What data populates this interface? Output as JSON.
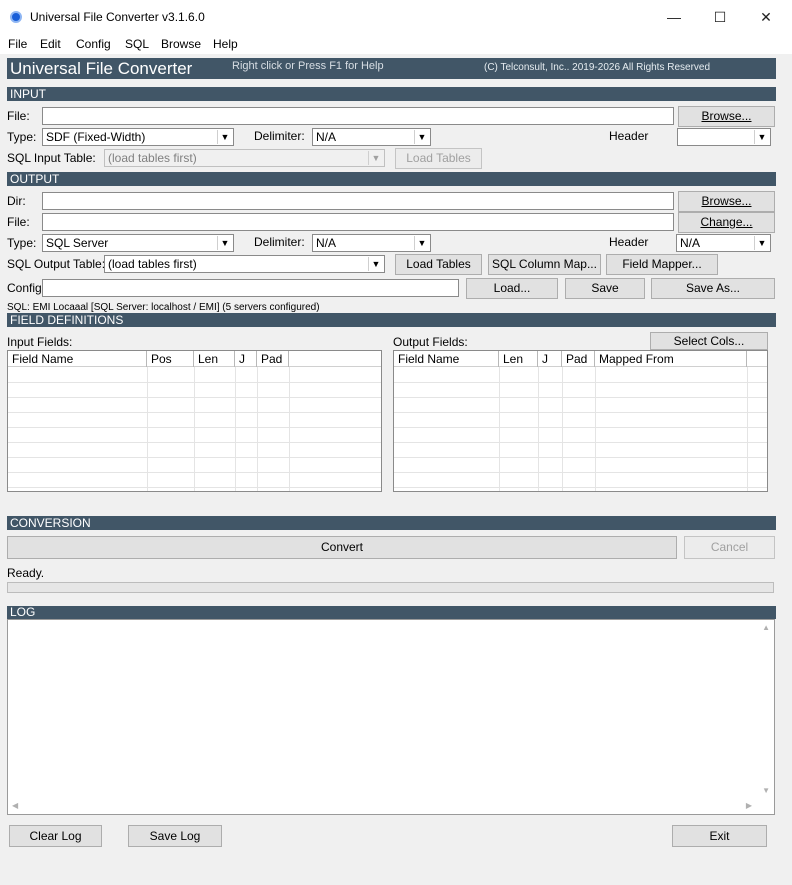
{
  "window": {
    "title": "Universal File Converter  v3.1.6.0",
    "minimize": "—",
    "maximize": "☐",
    "close": "✕"
  },
  "menu": [
    "File",
    "Edit",
    "Config",
    "SQL",
    "Browse",
    "Help"
  ],
  "banner": {
    "title": "Universal File Converter",
    "help": "Right click or Press F1 for Help",
    "copyright": "(C) Telconsult, Inc..  2019-2026  All Rights Reserved"
  },
  "input": {
    "section": "INPUT",
    "file_label": "File:",
    "file_value": "",
    "browse": "Browse...",
    "type_label": "Type:",
    "type_value": "SDF (Fixed-Width)",
    "delimiter_label": "Delimiter:",
    "delimiter_value": "N/A",
    "header_label": "Header",
    "header_value": "",
    "sql_table_label": "SQL Input Table:",
    "sql_table_value": "(load tables first)",
    "load_tables": "Load Tables"
  },
  "output": {
    "section": "OUTPUT",
    "dir_label": "Dir:",
    "dir_value": "",
    "browse": "Browse...",
    "file_label": "File:",
    "file_value": "",
    "change": "Change...",
    "type_label": "Type:",
    "type_value": "SQL Server",
    "delimiter_label": "Delimiter:",
    "delimiter_value": "N/A",
    "header_label": "Header",
    "header_value": "N/A",
    "sql_table_label": "SQL Output Table:",
    "sql_table_value": "(load tables first)",
    "load_tables": "Load Tables",
    "column_map": "SQL Column Map...",
    "field_mapper": "Field Mapper...",
    "config_label": "Config",
    "config_value": "",
    "load": "Load...",
    "save": "Save",
    "save_as": "Save As...",
    "sql_status": "SQL: EMI Locaaal  [SQL Server: localhost / EMI]   (5 servers configured)"
  },
  "fields": {
    "section": "FIELD DEFINITIONS",
    "input_label": "Input Fields:",
    "output_label": "Output Fields:",
    "select_cols": "Select Cols...",
    "input_columns": [
      "Field Name",
      "Pos",
      "Len",
      "J",
      "Pad"
    ],
    "output_columns": [
      "Field Name",
      "Len",
      "J",
      "Pad",
      "Mapped From"
    ]
  },
  "conversion": {
    "section": "CONVERSION",
    "convert": "Convert",
    "cancel": "Cancel",
    "status": "Ready.",
    "progress": 0
  },
  "log": {
    "section": "LOG",
    "content": ""
  },
  "footer": {
    "clear_log": "Clear Log",
    "save_log": "Save Log",
    "exit": "Exit"
  },
  "colors": {
    "section_bar": "#415667",
    "background": "#f0f0f0"
  }
}
